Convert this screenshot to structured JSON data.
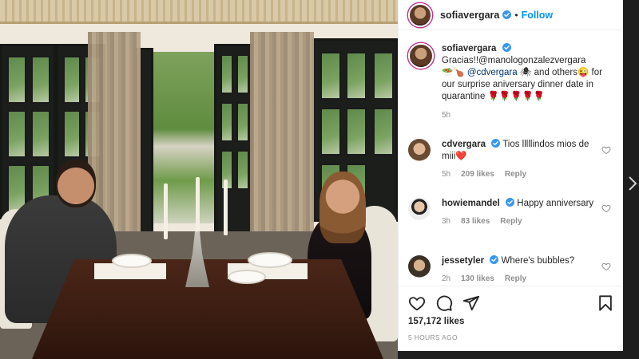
{
  "header": {
    "username": "sofiavergara",
    "separator": "•",
    "follow_label": "Follow"
  },
  "caption": {
    "username": "sofiavergara",
    "text_1": "Gracias!!@manologonzalezvergara",
    "emoji_1": "🥗🍗",
    "mention": "@cdvergara",
    "text_2": "🕷 and others😜",
    "text_3": "for our surprise aniversary dinner date in quarantine 🌹🌹🌹🌹🌹",
    "time": "5h"
  },
  "comments": [
    {
      "username": "cdvergara",
      "text": "Tios lllllindos mios de miii❤️",
      "time": "5h",
      "likes": "209 likes",
      "reply": "Reply"
    },
    {
      "username": "howiemandel",
      "text": "Happy anniversary",
      "time": "3h",
      "likes": "83 likes",
      "reply": "Reply"
    },
    {
      "username": "jessetyler",
      "text": "Where's bubbles?",
      "time": "2h",
      "likes": "130 likes",
      "reply": "Reply"
    }
  ],
  "footer": {
    "likes": "157,172 likes",
    "time": "5 HOURS AGO"
  },
  "colors": {
    "link": "#0095f6",
    "verified": "#3897f0",
    "meta": "#8e8e8e",
    "mention": "#00376b"
  },
  "icons": [
    "verified-badge-icon",
    "heart-icon",
    "comment-icon",
    "share-icon",
    "bookmark-icon",
    "chevron-right-icon"
  ]
}
